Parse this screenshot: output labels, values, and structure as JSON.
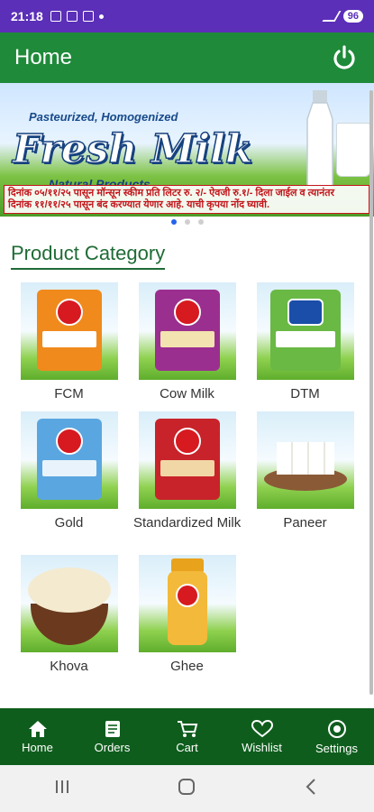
{
  "status_bar": {
    "time": "21:18",
    "battery": "96"
  },
  "app_bar": {
    "title": "Home"
  },
  "banner": {
    "subtitle": "Pasteurized, Homogenized",
    "headline": "Fresh Milk",
    "tagline": "Natural Products",
    "notice_line1": "दिनांक ०५/११/२५ पासून मॉन्सून स्कीम प्रति लिटर रु. २/- ऐवजी रु.१/- दिला जाईल व त्यानंतर",
    "notice_line2": "दिनांक ११/११/२५ पासून बंद करण्यात येणार आहे. याची कृपया नोंद घ्यावी."
  },
  "carousel": {
    "pages": 3,
    "active": 0
  },
  "section": {
    "title": "Product Category"
  },
  "categories": [
    {
      "label": "FCM"
    },
    {
      "label": "Cow Milk"
    },
    {
      "label": "DTM"
    },
    {
      "label": "Gold"
    },
    {
      "label": "Standardized Milk"
    },
    {
      "label": "Paneer"
    },
    {
      "label": "Khova"
    },
    {
      "label": "Ghee"
    }
  ],
  "bottom_nav": [
    {
      "label": "Home",
      "icon": "home-icon"
    },
    {
      "label": "Orders",
      "icon": "orders-icon"
    },
    {
      "label": "Cart",
      "icon": "cart-icon"
    },
    {
      "label": "Wishlist",
      "icon": "heart-icon"
    },
    {
      "label": "Settings",
      "icon": "settings-icon"
    }
  ],
  "colors": {
    "app_bar": "#1f8a3a",
    "bottom_nav": "#0f5d1d",
    "status_bar": "#5b2fb8",
    "title": "#1f6b35"
  }
}
